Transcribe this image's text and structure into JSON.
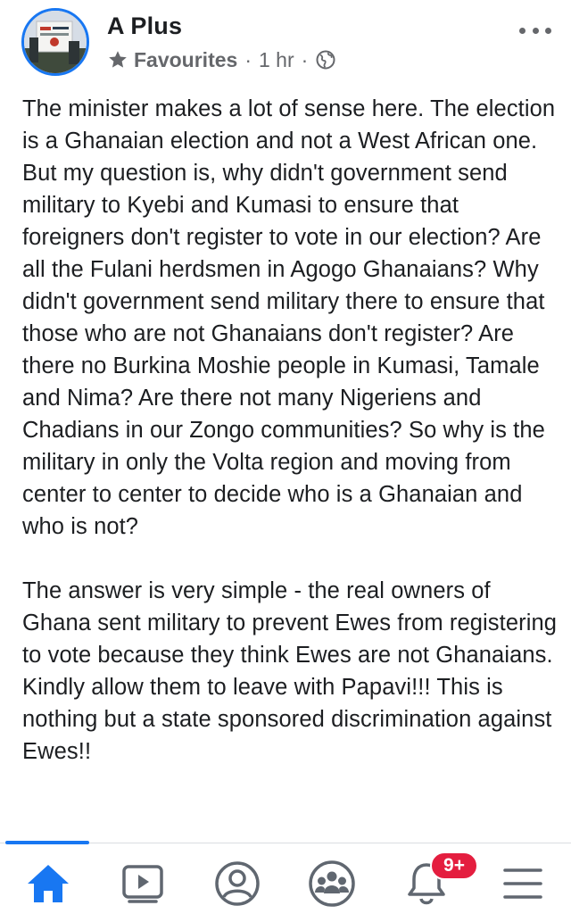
{
  "post": {
    "author": "A Plus",
    "audience": "Favourites",
    "separator": "·",
    "time": "1 hr",
    "privacy_icon": "globe-icon",
    "paragraphs": [
      "The minister makes a lot of sense here. The election is a Ghanaian election and not a West African one. But my question is, why didn't government send military to Kyebi and Kumasi to ensure that foreigners don't register to vote in our election? Are all the Fulani herdsmen in Agogo Ghanaians? Why didn't government send military there to ensure that those who are not Ghanaians don't register? Are there no Burkina Moshie people in Kumasi, Tamale and Nima? Are there not many Nigeriens and Chadians in our Zongo communities? So why is the military in only the Volta region and moving from center to center to decide who is a Ghanaian and who is not?",
      "The answer is very simple - the real owners of Ghana sent military to prevent Ewes from registering to vote because they think Ewes are not Ghanaians. Kindly allow them to leave with Papavi!!! This is nothing but a state sponsored discrimination against Ewes!!"
    ]
  },
  "tabbar": {
    "tabs": [
      {
        "name": "home",
        "icon": "home-icon",
        "active": true
      },
      {
        "name": "watch",
        "icon": "video-icon",
        "active": false
      },
      {
        "name": "profile",
        "icon": "profile-icon",
        "active": false
      },
      {
        "name": "groups",
        "icon": "groups-icon",
        "active": false
      },
      {
        "name": "notifications",
        "icon": "bell-icon",
        "active": false
      },
      {
        "name": "menu",
        "icon": "hamburger-icon",
        "active": false
      }
    ],
    "notifications_badge": "9+"
  },
  "colors": {
    "accent": "#1877f2",
    "text": "#1c1e21",
    "secondary_text": "#65676b",
    "badge": "#e41e3f",
    "icon_gray": "#606770"
  }
}
